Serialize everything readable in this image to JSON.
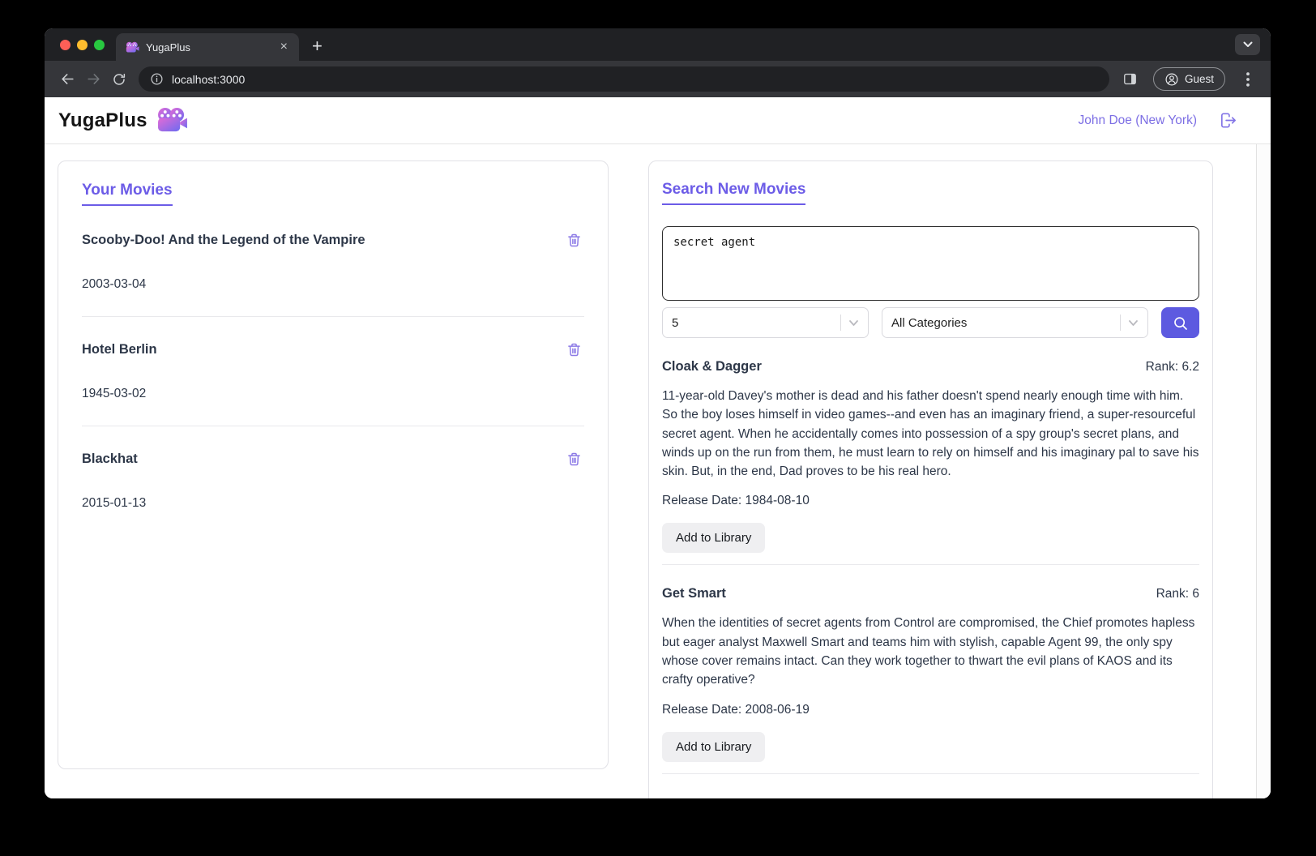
{
  "browser": {
    "tab_title": "YugaPlus",
    "close_glyph": "×",
    "new_tab_glyph": "+",
    "url": "localhost:3000",
    "guest_label": "Guest"
  },
  "header": {
    "app_title": "YugaPlus",
    "user": "John Doe (New York)"
  },
  "your_movies": {
    "title": "Your Movies",
    "movies": [
      {
        "title": "Scooby-Doo! And the Legend of the Vampire",
        "date": "2003-03-04"
      },
      {
        "title": "Hotel Berlin",
        "date": "1945-03-02"
      },
      {
        "title": "Blackhat",
        "date": "2015-01-13"
      }
    ]
  },
  "search": {
    "title": "Search New Movies",
    "query": "secret agent",
    "limit_value": "5",
    "category_value": "All Categories",
    "results": [
      {
        "title": "Cloak & Dagger",
        "rank": "Rank: 6.2",
        "description": "11-year-old Davey's mother is dead and his father doesn't spend nearly enough time with him. So the boy loses himself in video games--and even has an imaginary friend, a super-resourceful secret agent. When he accidentally comes into possession of a spy group's secret plans, and winds up on the run from them, he must learn to rely on himself and his imaginary pal to save his skin. But, in the end, Dad proves to be his real hero.",
        "release": "Release Date: 1984-08-10",
        "button_label": "Add to Library"
      },
      {
        "title": "Get Smart",
        "rank": "Rank: 6",
        "description": "When the identities of secret agents from Control are compromised, the Chief promotes hapless but eager analyst Maxwell Smart and teams him with stylish, capable Agent 99, the only spy whose cover remains intact. Can they work together to thwart the evil plans of KAOS and its crafty operative?",
        "release": "Release Date: 2008-06-19",
        "button_label": "Add to Library"
      }
    ]
  },
  "icons": {
    "movie_camera": "film-camera glyph (purple-pink gradient)",
    "trash": "trash-can outline",
    "logout": "door-with-right-arrow",
    "search": "magnifier",
    "info": "i-in-circle",
    "side_panel": "split-square",
    "guest_avatar": "person-in-circle",
    "menu": "⋮",
    "chevron_down": "∨",
    "back": "←",
    "forward": "→",
    "reload": "↻"
  },
  "colors": {
    "accent_purple": "#6c5ce7",
    "link_purple": "#7c6ee4",
    "icon_purple": "#8c7ae6",
    "search_button": "#5d5ae0",
    "text_dark": "#2d3748",
    "chrome_frame": "#202124",
    "chrome_toolbar": "#35363a",
    "traffic_red": "#ff5f57",
    "traffic_yellow": "#febc2e",
    "traffic_green": "#28c840"
  }
}
